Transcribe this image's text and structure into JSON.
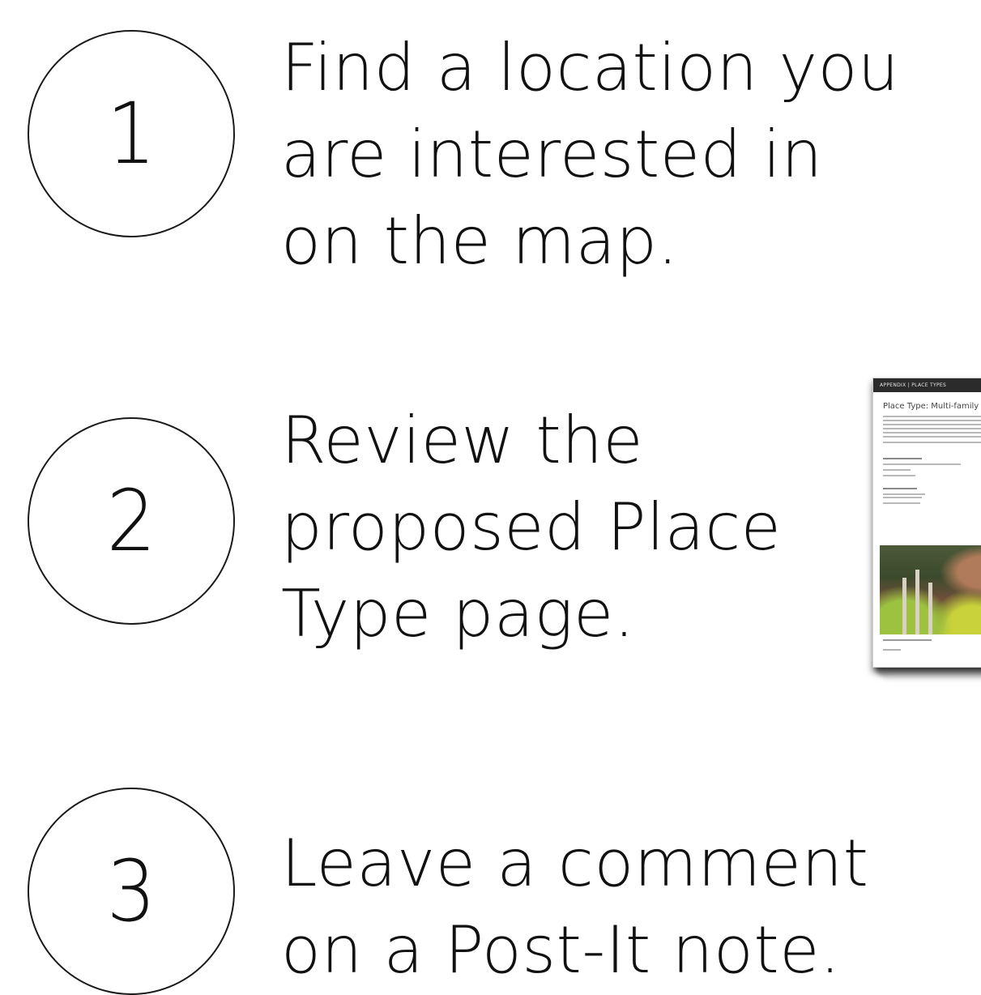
{
  "steps": [
    {
      "number": "1",
      "lines": [
        "Find a location you",
        "are interested in",
        "on the map."
      ]
    },
    {
      "number": "2",
      "lines": [
        "Review the",
        "proposed Place",
        "Type page."
      ]
    },
    {
      "number": "3",
      "lines": [
        "Leave a comment",
        "on a Post-It note."
      ]
    }
  ],
  "thumbnail": {
    "header": "APPENDIX | PLACE TYPES",
    "title": "Place Type: Multi-family"
  }
}
